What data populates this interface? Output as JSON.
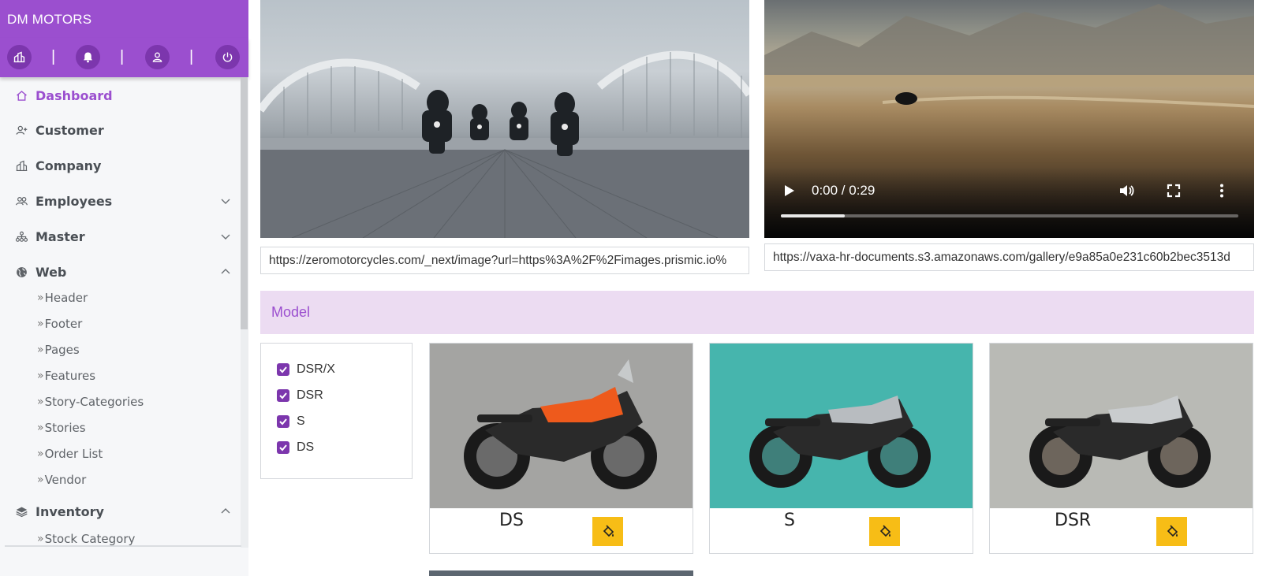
{
  "app": {
    "brand": "DM MOTORS"
  },
  "quick_bar": {
    "icons": [
      "company-chart-icon",
      "bell-icon",
      "user-icon",
      "power-icon"
    ],
    "separator": "|"
  },
  "sidebar": {
    "items": [
      {
        "label": "Dashboard",
        "icon": "home-icon",
        "active": true
      },
      {
        "label": "Customer",
        "icon": "user-plus-icon"
      },
      {
        "label": "Company",
        "icon": "building-icon"
      },
      {
        "label": "Employees",
        "icon": "users-icon",
        "expandable": true,
        "expanded": false
      },
      {
        "label": "Master",
        "icon": "sitemap-icon",
        "expandable": true,
        "expanded": false
      },
      {
        "label": "Web",
        "icon": "globe-icon",
        "expandable": true,
        "expanded": true
      },
      {
        "label": "Inventory",
        "icon": "layers-icon",
        "expandable": true,
        "expanded": true
      }
    ],
    "web_submenu": [
      "Header",
      "Footer",
      "Pages",
      "Features",
      "Story-Categories",
      "Stories",
      "Order List",
      "Vendor"
    ],
    "inventory_submenu": [
      "Stock Category"
    ]
  },
  "media": {
    "image_url": "https://zeromotorcycles.com/_next/image?url=https%3A%2F%2Fimages.prismic.io%",
    "video_url": "https://vaxa-hr-documents.s3.amazonaws.com/gallery/e9a85a0e231c60b2bec3513d",
    "video_time": "0:00 / 0:29",
    "video_progress_fraction": 0.14
  },
  "model_section": {
    "title": "Model",
    "filters": [
      {
        "label": "DSR/X",
        "checked": true
      },
      {
        "label": "DSR",
        "checked": true
      },
      {
        "label": "S",
        "checked": true
      },
      {
        "label": "DS",
        "checked": true
      }
    ],
    "cards": [
      {
        "name": "DS",
        "bg": "#a4a4a2",
        "accent": "#ee5a1c"
      },
      {
        "name": "S",
        "bg": "#46b5ad",
        "accent": "#b8bcc0"
      },
      {
        "name": "DSR",
        "bg": "#b9bab5",
        "accent": "#c9ccce"
      }
    ]
  },
  "colors": {
    "brand_purple": "#9b4fcf",
    "checkbox_purple": "#7c36ad",
    "edit_button_yellow": "#f7bd16",
    "model_header_bg": "#ecdcf2"
  }
}
